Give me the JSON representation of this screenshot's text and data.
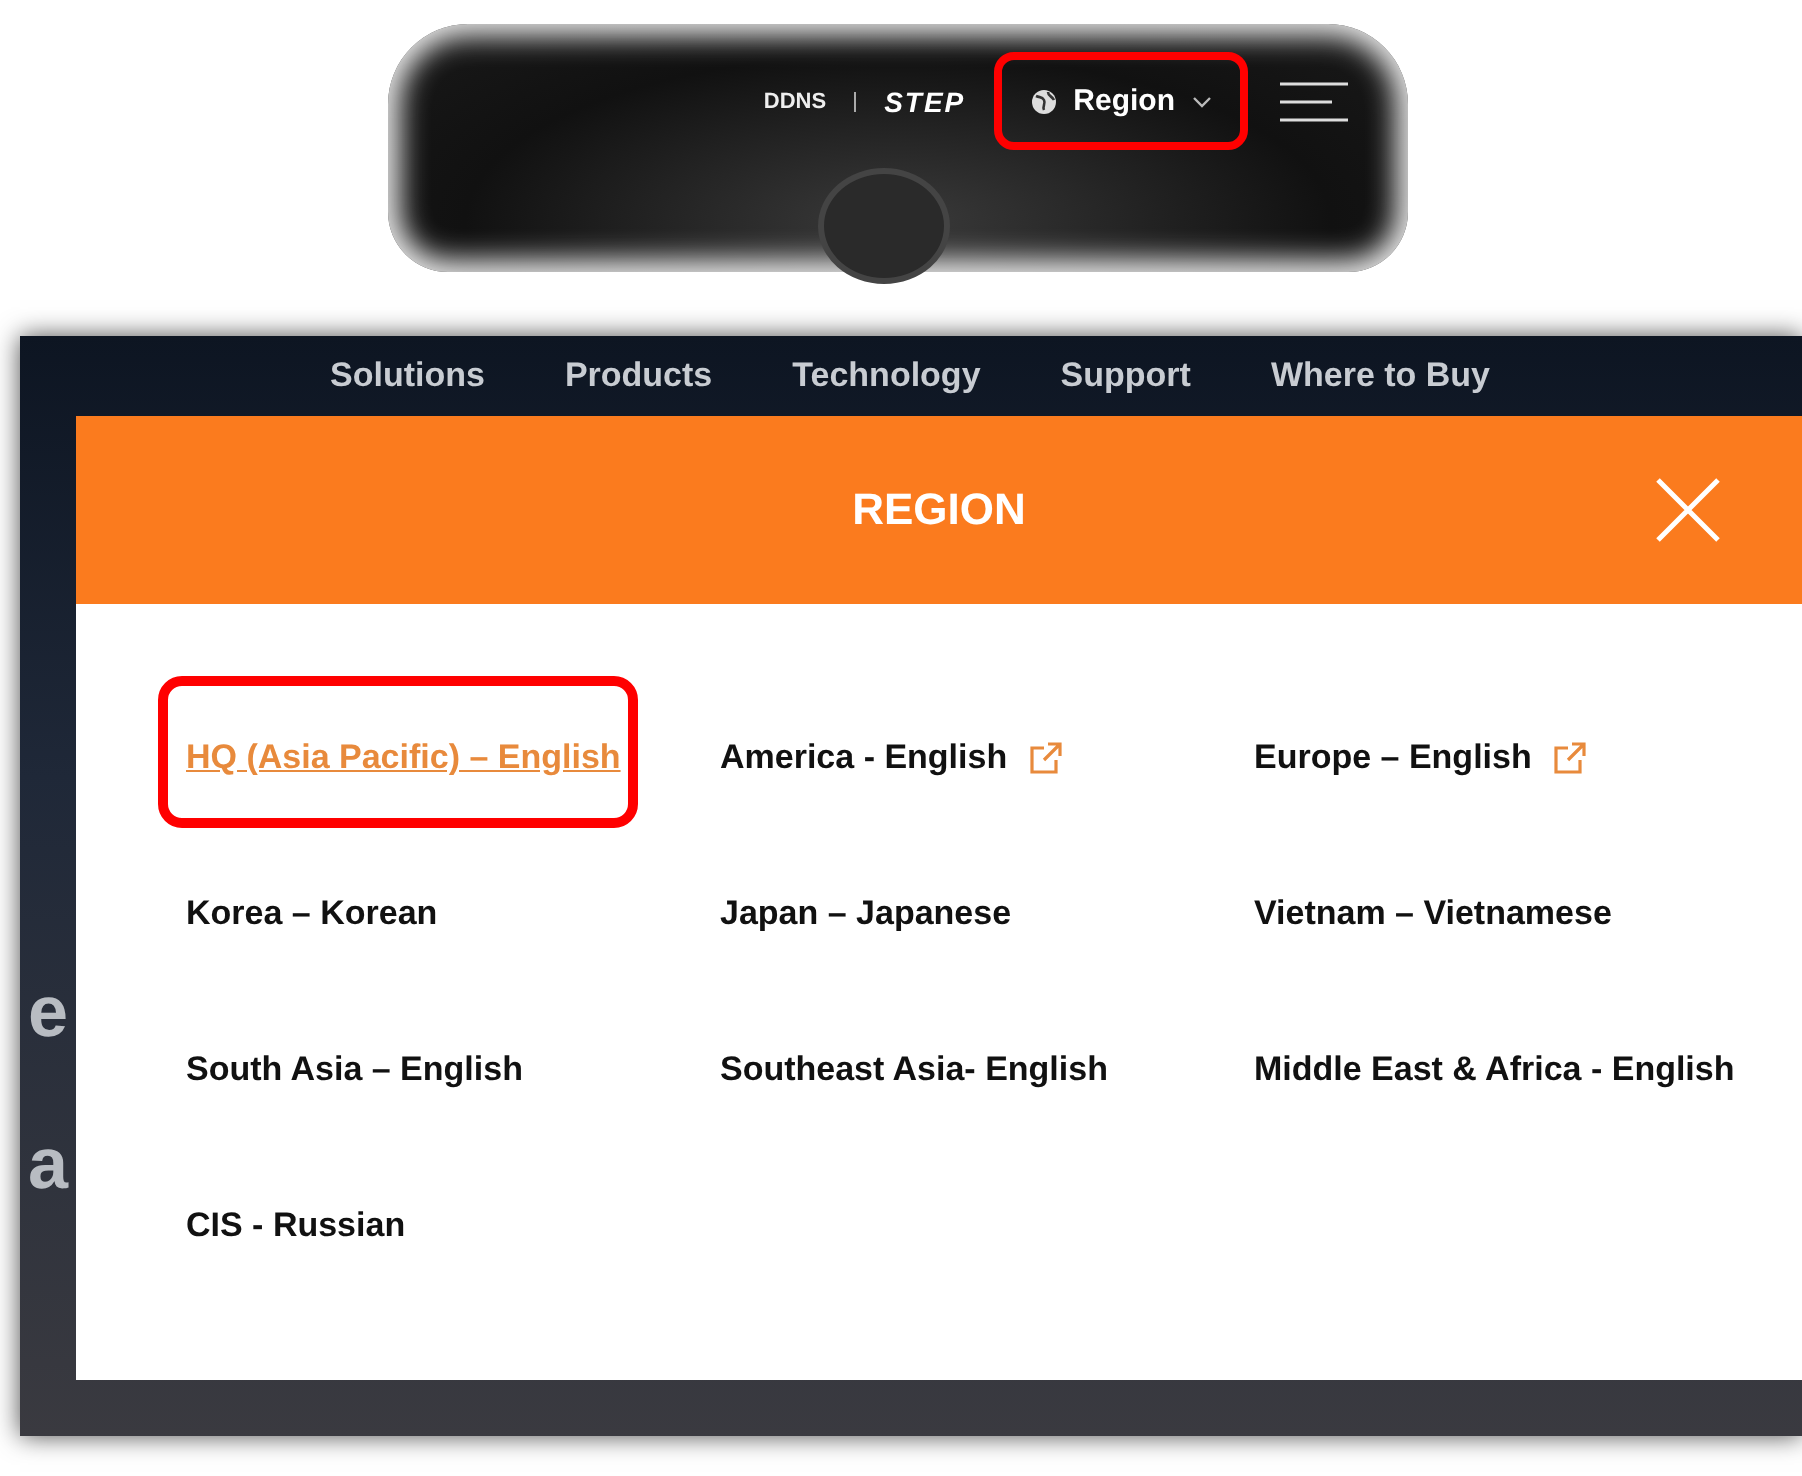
{
  "top_shot": {
    "nav": [
      {
        "label": "DDNS",
        "kind": "plain"
      },
      {
        "label": "STEP",
        "kind": "logo"
      }
    ],
    "region_button": {
      "label": "Region",
      "highlighted": true
    }
  },
  "bottom_shot": {
    "nav": [
      "Solutions",
      "Products",
      "Technology",
      "Support",
      "Where to Buy"
    ],
    "hero_fragments": [
      "e",
      "a"
    ],
    "dialog": {
      "title": "REGION",
      "regions": [
        {
          "label": "HQ (Asia Pacific) – English",
          "selected": true,
          "external": false,
          "highlighted": true
        },
        {
          "label": "America - English",
          "selected": false,
          "external": true,
          "highlighted": false
        },
        {
          "label": "Europe – English",
          "selected": false,
          "external": true,
          "highlighted": false
        },
        {
          "label": "Korea – Korean",
          "selected": false,
          "external": false,
          "highlighted": false
        },
        {
          "label": "Japan – Japanese",
          "selected": false,
          "external": false,
          "highlighted": false
        },
        {
          "label": "Vietnam – Vietnamese",
          "selected": false,
          "external": false,
          "highlighted": false
        },
        {
          "label": "South Asia – English",
          "selected": false,
          "external": false,
          "highlighted": false
        },
        {
          "label": "Southeast Asia- English",
          "selected": false,
          "external": false,
          "highlighted": false
        },
        {
          "label": "Middle East & Africa - English",
          "selected": false,
          "external": false,
          "highlighted": false
        },
        {
          "label": "CIS - Russian",
          "selected": false,
          "external": false,
          "highlighted": false
        }
      ]
    }
  }
}
